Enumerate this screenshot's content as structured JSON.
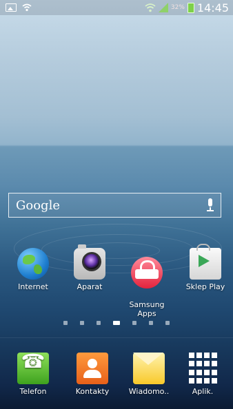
{
  "status_bar": {
    "battery_percent": "32%",
    "time": "14:45",
    "left_icons": [
      "picture-icon",
      "wifi-icon"
    ],
    "right_icons": [
      "wifi-icon",
      "signal-icon",
      "battery-icon"
    ]
  },
  "search_widget": {
    "label": "Google",
    "icon": "microphone-icon"
  },
  "home_apps": [
    {
      "label": "Internet",
      "icon": "globe-icon"
    },
    {
      "label": "Aparat",
      "icon": "camera-icon"
    },
    {
      "label": "Samsung\nApps",
      "icon": "shopping-bag-icon"
    },
    {
      "label": "Sklep Play",
      "icon": "play-store-icon"
    }
  ],
  "page_indicator": {
    "count": 7,
    "active_index": 3
  },
  "dock": [
    {
      "label": "Telefon",
      "icon": "phone-icon"
    },
    {
      "label": "Kontakty",
      "icon": "contacts-icon"
    },
    {
      "label": "Wiadomo..",
      "icon": "messages-icon"
    },
    {
      "label": "Aplik.",
      "icon": "apps-grid-icon"
    }
  ],
  "colors": {
    "battery": "#7ed04a",
    "phone": "#4ab626",
    "contacts": "#f07824",
    "messages": "#f8c92a"
  }
}
